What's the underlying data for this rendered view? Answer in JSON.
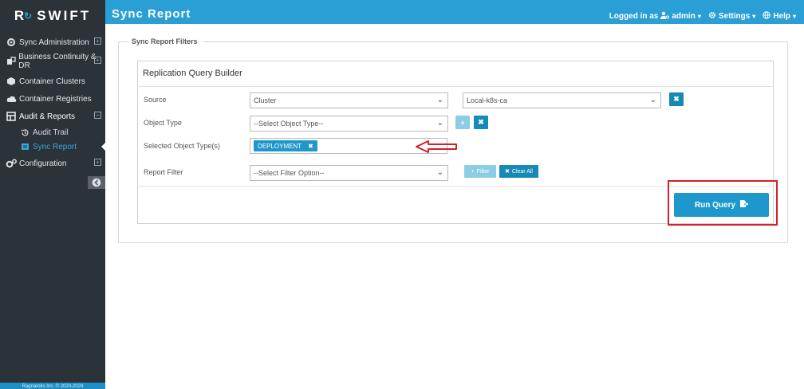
{
  "brand": {
    "logo_letter": "R",
    "name": "SWIFT"
  },
  "sidebar": {
    "items": [
      {
        "label": "Sync Administration",
        "icon": "sync-admin-icon",
        "expander": "+"
      },
      {
        "label": "Business Continuity & DR",
        "icon": "bcdr-icon",
        "expander": "+"
      },
      {
        "label": "Container Clusters",
        "icon": "clusters-icon",
        "expander": ""
      },
      {
        "label": "Container Registries",
        "icon": "registries-icon",
        "expander": ""
      },
      {
        "label": "Audit & Reports",
        "icon": "reports-icon",
        "expander": "−"
      },
      {
        "label": "Configuration",
        "icon": "gears-icon",
        "expander": "+"
      }
    ],
    "subitems": [
      {
        "label": "Audit Trail",
        "icon": "history-icon"
      },
      {
        "label": "Sync Report",
        "icon": "report-icon"
      }
    ],
    "footer": "Ragnaroks Inc. © 2020-2024"
  },
  "header": {
    "title": "Sync Report",
    "logged_in_prefix": "Logged in as",
    "user": "admin",
    "settings": "Settings",
    "help": "Help"
  },
  "filters": {
    "legend": "Sync Report Filters",
    "builder_title": "Replication Query Builder",
    "source_label": "Source",
    "source_value": "Cluster",
    "source_target_value": "Local-k8s-ca",
    "object_type_label": "Object Type",
    "object_type_placeholder": "--Select Object Type--",
    "selected_types_label": "Selected Object Type(s)",
    "selected_tags": [
      "DEPLOYMENT"
    ],
    "report_filter_label": "Report Filter",
    "report_filter_placeholder": "--Select Filter Option--",
    "filter_button": "Filter",
    "clear_all_button": "Clear All",
    "run_query_button": "Run Query"
  },
  "colors": {
    "topbar": "#2a9fd6",
    "sidebar": "#2b3238",
    "accent": "#1789b6",
    "highlight": "#d32127"
  }
}
